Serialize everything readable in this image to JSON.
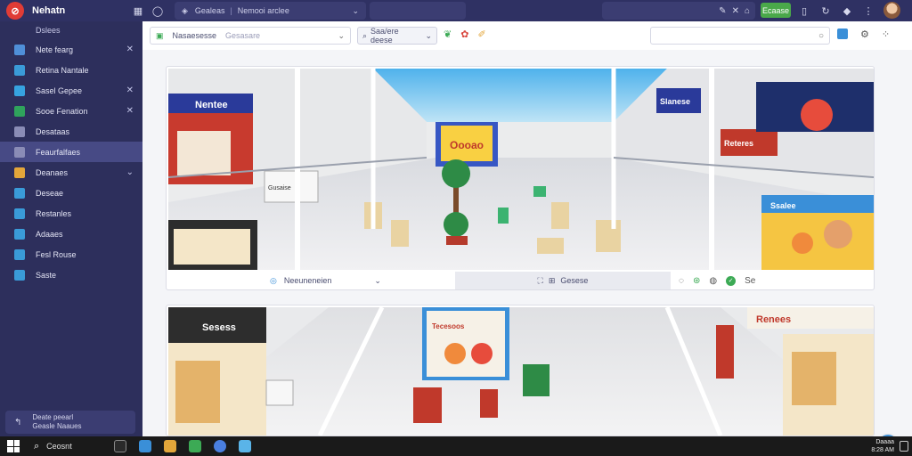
{
  "app": {
    "title": "Nehatn",
    "logo_glyph": "⊘"
  },
  "topbar": {
    "tab_main": "Gealeas",
    "tab_secondary": "Nemooi arclee",
    "right_pill_icons": [
      "✎",
      "✕",
      "⌂"
    ],
    "green_button": "Ecaase",
    "icons": [
      "bookmark-icon",
      "chat-icon",
      "shield-icon",
      "settings-icon",
      "more-icon"
    ]
  },
  "sidebar": {
    "header": "Dslees",
    "items": [
      {
        "label": "Nete fearg",
        "icon_color": "#4f8fd8",
        "closeable": true
      },
      {
        "label": "Retina Nantale",
        "icon_color": "#3a9bd8",
        "closeable": false
      },
      {
        "label": "Sasel Gepee",
        "icon_color": "#36a3e0",
        "closeable": true
      },
      {
        "label": "Sooe Fenation",
        "icon_color": "#2fa35c",
        "closeable": true
      },
      {
        "label": "Desataas",
        "icon_color": "#8a8cb6",
        "closeable": false
      },
      {
        "label": "Feaurfalfaes",
        "icon_color": "#8a8cb6",
        "closeable": false,
        "active": true
      },
      {
        "label": "Deanaes",
        "icon_color": "#e3a63a",
        "closeable": false,
        "chevron": true
      },
      {
        "label": "Deseae",
        "icon_color": "#3a9bd8",
        "closeable": false
      },
      {
        "label": "Restanles",
        "icon_color": "#3a9bd8",
        "closeable": false
      },
      {
        "label": "Adaaes",
        "icon_color": "#3a9bd8",
        "closeable": false
      },
      {
        "label": "Fesl Rouse",
        "icon_color": "#3a9bd8",
        "closeable": false
      },
      {
        "label": "Saste",
        "icon_color": "#3a9bd8",
        "closeable": false
      }
    ],
    "footer_line1": "Deate peearl",
    "footer_line2": "Geasle Naaues"
  },
  "toolbar": {
    "dropdown1_label": "Nasaesesse",
    "dropdown1_value": "Gesasare",
    "dropdown2_label": "Saa/ere deese",
    "tool_icons": [
      "leaf-icon",
      "palette-icon",
      "brush-icon"
    ]
  },
  "image_bar": {
    "left_label": "Neeuneneien",
    "mid_label": "Gesese",
    "right_label": "Se"
  },
  "mall_signs": {
    "top_left": "Nentee",
    "top_right": "Slanese",
    "center_banner": "Oooao",
    "left_mid": "Gusaise",
    "right_red": "Reteres",
    "right_poster": "Ssalee",
    "bottom_left": "Sesess",
    "bottom_center": "Tecesoos",
    "bottom_right": "Renees"
  },
  "taskbar": {
    "search_text": "Ceosnt",
    "tray_line1": "Daaaa",
    "tray_line2": "8:28 AM"
  }
}
